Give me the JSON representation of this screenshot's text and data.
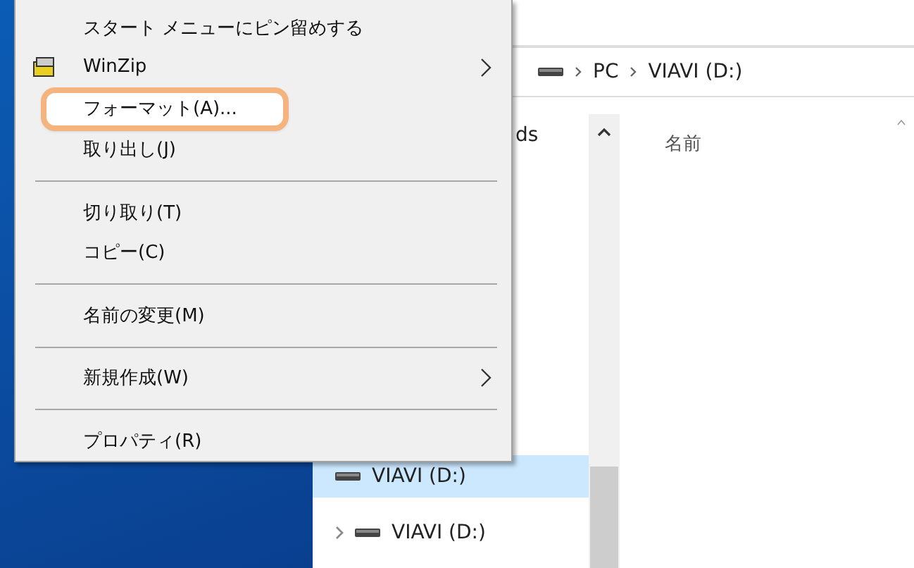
{
  "context_menu": {
    "items": [
      {
        "kind": "item",
        "label": "スタート メニューにピン留めする",
        "icon": false,
        "submenu": false,
        "selected": false
      },
      {
        "kind": "item",
        "label": "WinZip",
        "icon": true,
        "submenu": true,
        "selected": false
      },
      {
        "kind": "item",
        "label": "フォーマット(A)...",
        "icon": false,
        "submenu": false,
        "selected": true
      },
      {
        "kind": "item",
        "label": "取り出し(J)",
        "icon": false,
        "submenu": false,
        "selected": false
      },
      {
        "kind": "separator"
      },
      {
        "kind": "item",
        "label": "切り取り(T)",
        "icon": false,
        "submenu": false,
        "selected": false
      },
      {
        "kind": "item",
        "label": "コピー(C)",
        "icon": false,
        "submenu": false,
        "selected": false
      },
      {
        "kind": "separator"
      },
      {
        "kind": "item",
        "label": "名前の変更(M)",
        "icon": false,
        "submenu": false,
        "selected": false
      },
      {
        "kind": "separator"
      },
      {
        "kind": "item",
        "label": "新規作成(W)",
        "icon": false,
        "submenu": true,
        "selected": false
      },
      {
        "kind": "separator"
      },
      {
        "kind": "item",
        "label": "プロパティ(R)",
        "icon": false,
        "submenu": false,
        "selected": false
      }
    ]
  },
  "address_bar": {
    "path": [
      "PC",
      "VIAVI (D:)"
    ]
  },
  "navigation_pane": {
    "items": [
      {
        "label": "ds",
        "expandable": false,
        "drive": false,
        "selected": false
      },
      {
        "label": "VIAVI (D:)",
        "expandable": false,
        "drive": true,
        "selected": true
      },
      {
        "label": "VIAVI (D:)",
        "expandable": true,
        "drive": true,
        "selected": false
      }
    ]
  },
  "file_list": {
    "columns": [
      "名前"
    ]
  }
}
